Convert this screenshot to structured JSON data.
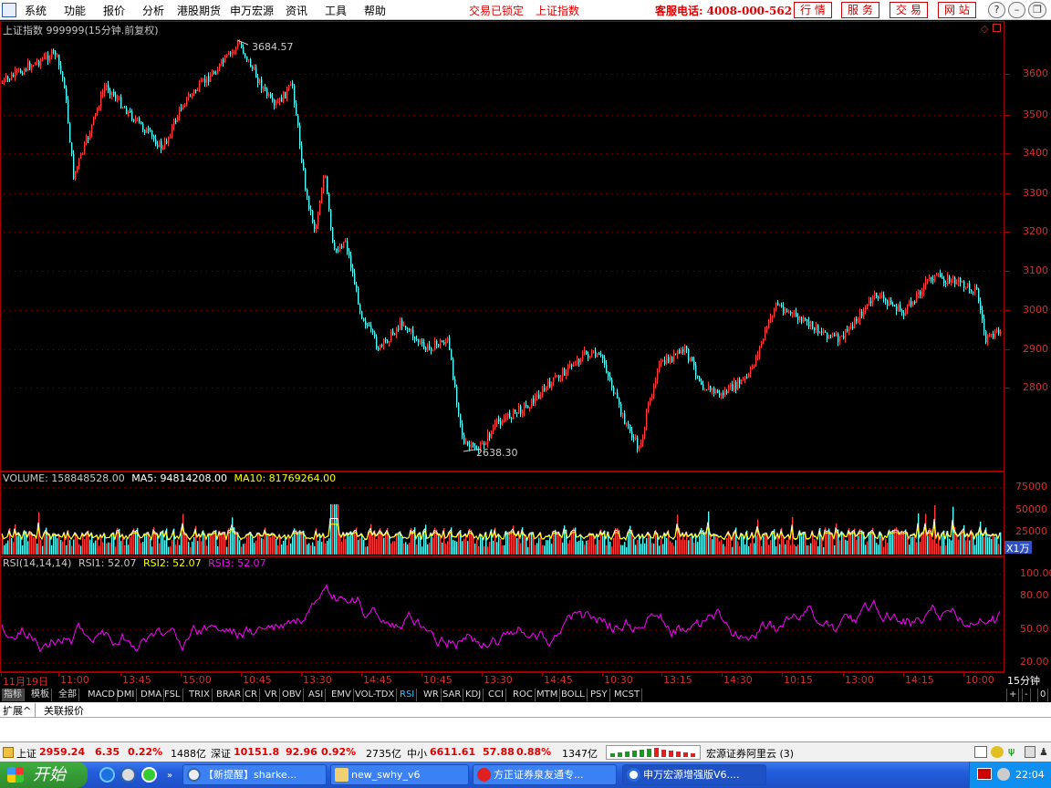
{
  "menubar": {
    "items": [
      "系统",
      "功能",
      "报价",
      "分析",
      "港股期货",
      "申万宏源",
      "资讯",
      "工具",
      "帮助"
    ],
    "status_locked": "交易已锁定",
    "status_index": "上证指数",
    "hotline": "客服电话: 4008-000-562",
    "tabs": [
      "行 情",
      "服 务",
      "交 易",
      "网 站"
    ],
    "window_buttons": [
      "?",
      "–",
      "❐",
      "✕"
    ]
  },
  "price_pane": {
    "title": "上证指数 999999(15分钟.前复权)",
    "high_label": "3684.57",
    "low_label": "2638.30",
    "y_ticks": [
      "3600",
      "3500",
      "3400",
      "3300",
      "3200",
      "3100",
      "3000",
      "2900",
      "2800"
    ],
    "corner_icons": [
      "diamond-icon",
      "square-icon"
    ]
  },
  "volume_pane": {
    "label_volume": "VOLUME: 158848528.00",
    "label_ma5": "MA5: 94814208.00",
    "label_ma10": "MA10: 81769264.00",
    "y_ticks": [
      "75000",
      "50000",
      "25000"
    ],
    "unit": "X1万"
  },
  "rsi_pane": {
    "label_rsi": "RSI(14,14,14)",
    "label_rsi1": "RSI1: 52.07",
    "label_rsi2": "RSI2: 52.07",
    "label_rsi3": "RSI3: 52.07",
    "y_ticks": [
      "100.00",
      "80.00",
      "50.00",
      "20.00"
    ]
  },
  "time_axis": {
    "ticks": [
      "11月19日",
      "11:00",
      "13:45",
      "15:00",
      "10:45",
      "13:30",
      "14:45",
      "10:45",
      "13:30",
      "14:45",
      "10:30",
      "13:15",
      "14:30",
      "10:15",
      "13:00",
      "14:15",
      "10:00"
    ],
    "period": "15分钟"
  },
  "indicator_tabs": [
    "指标",
    "模板",
    "全部",
    "MACD",
    "DMI",
    "DMA",
    "FSL",
    "TRIX",
    "BRAR",
    "CR",
    "VR",
    "OBV",
    "ASI",
    "EMV",
    "VOL-TDX",
    "RSI",
    "WR",
    "SAR",
    "KDJ",
    "CCI",
    "ROC",
    "MTM",
    "BOLL",
    "PSY",
    "MCST"
  ],
  "active_indicator": "RSI",
  "indicator_controls": [
    "+",
    "-",
    "0"
  ],
  "extra_tabs": [
    "扩展^",
    "关联报价"
  ],
  "statusbar": {
    "sh_name": "上证",
    "sh_price": "2959.24",
    "sh_change": "6.35",
    "sh_pct": "0.22%",
    "sh_amount": "1488亿",
    "sz_name": "深证",
    "sz_price": "10151.8",
    "sz_change": "92.96",
    "sz_pct": "0.92%",
    "sz_amount": "2735亿",
    "sme_name": "中小",
    "sme_price": "6611.61",
    "sme_change": "57.88",
    "sme_pct": "0.88%",
    "sme_amount": "1347亿",
    "server": "宏源证券阿里云 (3)"
  },
  "taskbar": {
    "start_label": "开始",
    "buttons": [
      "【新提醒】sharke...",
      "new_swhy_v6",
      "方正证券泉友通专...",
      "申万宏源增强版V6...."
    ],
    "clock": "22:04"
  },
  "colors": {
    "up": "#ff3c3c",
    "down": "#54fcfc",
    "ma5": "#ffffff",
    "ma10": "#ffff00",
    "rsi": "#ff00ff",
    "axis": "#a00000"
  }
}
